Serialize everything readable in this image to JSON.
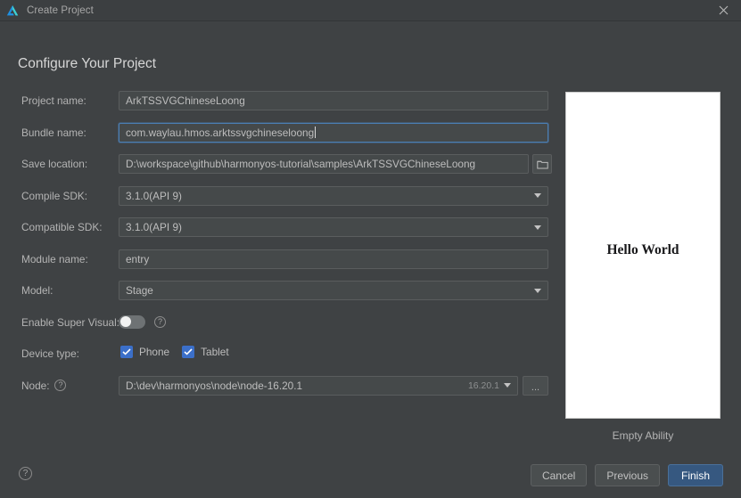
{
  "window": {
    "title": "Create Project",
    "logo_icon": "deveco-triangle-logo",
    "close_icon": "close-icon"
  },
  "heading": "Configure Your Project",
  "form": {
    "project_name": {
      "label": "Project name:",
      "value": "ArkTSSVGChineseLoong"
    },
    "bundle_name": {
      "label": "Bundle name:",
      "value": "com.waylau.hmos.arktssvgchineseloong",
      "focused": true
    },
    "save_location": {
      "label": "Save location:",
      "value": "D:\\workspace\\github\\harmonyos-tutorial\\samples\\ArkTSSVGChineseLoong",
      "browse_icon": "folder-icon"
    },
    "compile_sdk": {
      "label": "Compile SDK:",
      "value": "3.1.0(API 9)",
      "options": [
        "3.1.0(API 9)"
      ],
      "arrow_icon": "chevron-down-icon"
    },
    "compatible_sdk": {
      "label": "Compatible SDK:",
      "value": "3.1.0(API 9)",
      "options": [
        "3.1.0(API 9)"
      ],
      "arrow_icon": "chevron-down-icon"
    },
    "module_name": {
      "label": "Module name:",
      "value": "entry"
    },
    "model": {
      "label": "Model:",
      "value": "Stage",
      "options": [
        "Stage"
      ],
      "arrow_icon": "chevron-down-icon"
    },
    "enable_super_visual": {
      "label": "Enable Super Visual:",
      "state": "off",
      "help_icon": "question-circle-icon"
    },
    "device_type": {
      "label": "Device type:",
      "items": [
        {
          "label": "Phone",
          "checked": true
        },
        {
          "label": "Tablet",
          "checked": true
        }
      ],
      "check_icon": "check-icon"
    },
    "node": {
      "label": "Node:",
      "help_icon": "question-circle-icon",
      "value": "D:\\dev\\harmonyos\\node\\node-16.20.1",
      "version": "16.20.1",
      "arrow_icon": "chevron-down-icon",
      "browse_label": "...",
      "browse_name": "browse-ellipsis-button"
    }
  },
  "preview": {
    "phone_text": "Hello World",
    "caption": "Empty Ability"
  },
  "footer": {
    "help_icon": "question-circle-icon",
    "cancel": "Cancel",
    "previous": "Previous",
    "finish": "Finish"
  },
  "colors": {
    "window_bg": "#3f4244",
    "titlebar_bg": "#3c3f41",
    "field_bg": "#45494a",
    "accent_focus": "#4b7fb5",
    "accent_checkbox": "#3b6fc9",
    "primary_button": "#365880",
    "logo_blue": "#1f8fe0",
    "logo_cyan": "#3fd0d0"
  }
}
